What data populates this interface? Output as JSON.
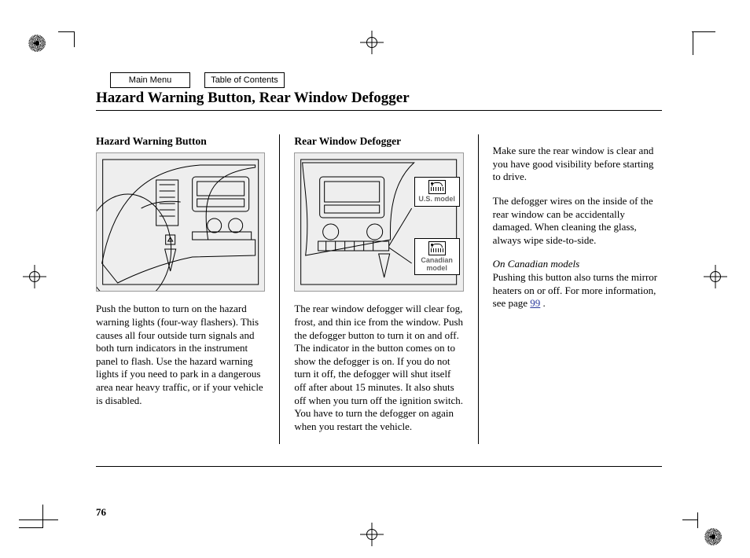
{
  "nav": {
    "main_menu": "Main Menu",
    "toc": "Table of Contents"
  },
  "title": "Hazard Warning Button, Rear Window Defogger",
  "colA": {
    "heading": "Hazard Warning Button",
    "body": "Push the button to turn on the hazard warning lights (four-way flashers). This causes all four outside turn signals and both turn indicators in the instrument panel to flash. Use the hazard warning lights if you need to park in a dangerous area near heavy traffic, or if your vehicle is disabled."
  },
  "colB": {
    "heading": "Rear Window Defogger",
    "callout_us": "U.S. model",
    "callout_ca": "Canadian model",
    "body": "The rear window defogger will clear fog, frost, and thin ice from the window. Push the defogger button to turn it on and off. The indicator in the button comes on to show the defogger is on. If you do not turn it off, the defogger will shut itself off after about 15 minutes. It also shuts off when you turn off the ignition switch. You have to turn the defogger on again when you restart the vehicle."
  },
  "colC": {
    "p1": "Make sure the rear window is clear and you have good visibility before starting to drive.",
    "p2": "The defogger wires on the inside of the rear window can be accidentally damaged. When cleaning the glass, always wipe side-to-side.",
    "note_label": "On Canadian models",
    "p3a": "Pushing this button also turns the mirror heaters on or off. For more information, see page ",
    "page_ref": "99",
    "p3b": " ."
  },
  "page_number": "76"
}
